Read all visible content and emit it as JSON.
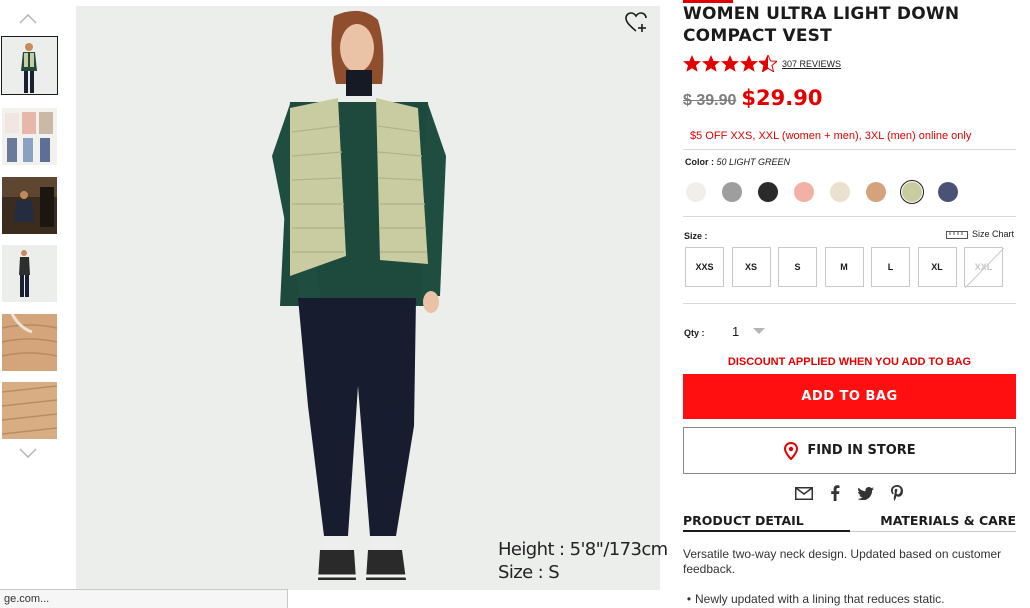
{
  "gallery": {
    "thumbnails": [
      {
        "name": "thumbnail-1",
        "selected": true
      },
      {
        "name": "thumbnail-2",
        "selected": false
      },
      {
        "name": "thumbnail-3",
        "selected": false
      },
      {
        "name": "thumbnail-4",
        "selected": false
      },
      {
        "name": "thumbnail-5",
        "selected": false
      },
      {
        "name": "thumbnail-6",
        "selected": false
      }
    ],
    "up_icon": "chevron-up-icon",
    "down_icon": "chevron-down-icon",
    "favorite_icon": "heart-plus-icon",
    "model_height": "Height : 5'8\"/173cm",
    "model_size": "Size : S"
  },
  "status_bar": {
    "text": "ge.com..."
  },
  "product": {
    "title_line1": "WOMEN ULTRA LIGHT DOWN",
    "title_line2": "COMPACT VEST",
    "rating": 4.5,
    "reviews": "307 REVIEWS",
    "price_original": "$ 39.90",
    "price_sale": "$29.90",
    "promo": "$5 OFF XXS, XXL (women + men), 3XL (men) online only",
    "color_label": "Color :",
    "color_value": "50 LIGHT GREEN",
    "colors": [
      {
        "name": "off-white",
        "hex": "#f2efea",
        "selected": false
      },
      {
        "name": "gray",
        "hex": "#9e9e9e",
        "selected": false
      },
      {
        "name": "black",
        "hex": "#2a2a2a",
        "selected": false
      },
      {
        "name": "pink",
        "hex": "#f2b1a4",
        "selected": false
      },
      {
        "name": "beige",
        "hex": "#ebe0d0",
        "selected": false
      },
      {
        "name": "camel",
        "hex": "#d4a27c",
        "selected": false
      },
      {
        "name": "light-green",
        "hex": "#c9cca1",
        "selected": true
      },
      {
        "name": "navy",
        "hex": "#4a5376",
        "selected": false
      }
    ],
    "size_label": "Size :",
    "size_chart": "Size Chart",
    "sizes": [
      {
        "label": "XXS",
        "available": true
      },
      {
        "label": "XS",
        "available": true
      },
      {
        "label": "S",
        "available": true
      },
      {
        "label": "M",
        "available": true
      },
      {
        "label": "L",
        "available": true
      },
      {
        "label": "XL",
        "available": true
      },
      {
        "label": "XXL",
        "available": false
      }
    ],
    "qty_label": "Qty :",
    "qty_value": "1",
    "discount_note": "DISCOUNT APPLIED WHEN YOU ADD TO BAG",
    "add_to_bag": "ADD TO BAG",
    "find_in_store": "FIND IN STORE",
    "share_icons": [
      "email-icon",
      "facebook-icon",
      "twitter-icon",
      "pinterest-icon"
    ],
    "tabs": [
      "PRODUCT DETAIL",
      "MATERIALS & CARE"
    ],
    "description": "Versatile two-way neck design. Updated based on customer feedback.",
    "bullet": "Newly updated with a lining that reduces static."
  },
  "colors": {
    "accent_red": "#e30000",
    "button_red": "#ff0f0f"
  }
}
